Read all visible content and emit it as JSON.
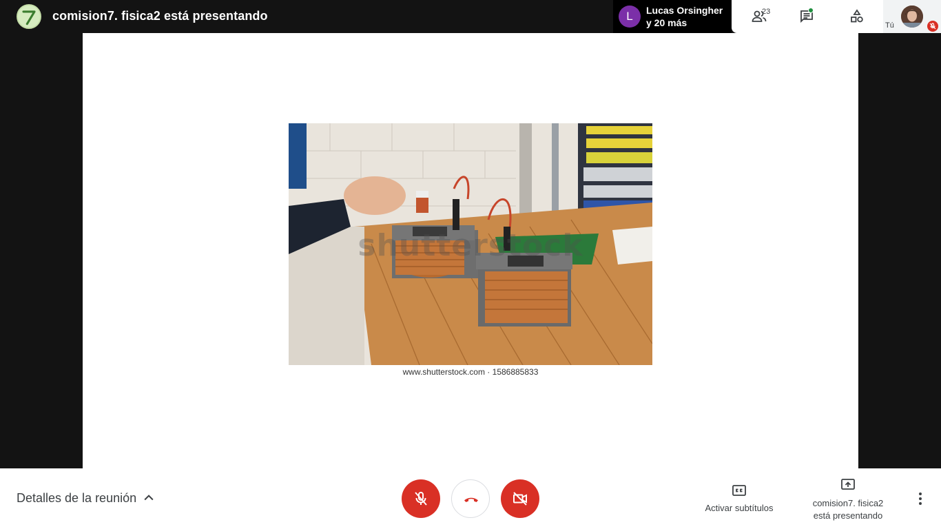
{
  "header": {
    "presenting_title": "comision7. fisica2 está presentando",
    "participants_chip": {
      "avatar_letter": "L",
      "line1": "Lucas Orsingher",
      "line2": "y 20 más"
    },
    "people_count": "23",
    "self_label": "Tú"
  },
  "slide": {
    "watermark": "shutterstock",
    "caption": "www.shutterstock.com · 1586885833"
  },
  "footer": {
    "details_label": "Detalles de la reunión",
    "captions_label": "Activar subtítulos",
    "presenting_line1": "comision7. fisica2",
    "presenting_line2": "está presentando"
  },
  "colors": {
    "background": "#131313",
    "danger_red": "#d93025",
    "chip_avatar": "#7b2fa8",
    "chat_dot": "#1e8e3e"
  },
  "icons": [
    "presenter-avatar",
    "people-icon",
    "chat-icon",
    "activities-icon",
    "mic-off-icon",
    "hang-up-icon",
    "camera-off-icon",
    "closed-captions-icon",
    "present-screen-icon",
    "more-vert-icon",
    "chevron-up-icon"
  ]
}
